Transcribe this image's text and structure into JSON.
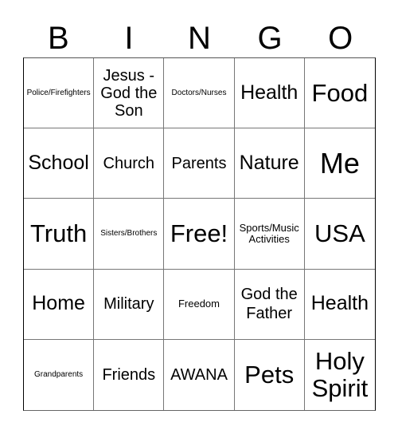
{
  "header": [
    "B",
    "I",
    "N",
    "G",
    "O"
  ],
  "cells": [
    "Police/Firefighters",
    "Jesus - God the Son",
    "Doctors/Nurses",
    "Health",
    "Food",
    "School",
    "Church",
    "Parents",
    "Nature",
    "Me",
    "Truth",
    "Sisters/Brothers",
    "Free!",
    "Sports/Music Activities",
    "USA",
    "Home",
    "Military",
    "Freedom",
    "God the Father",
    "Health",
    "Grandparents",
    "Friends",
    "AWANA",
    "Pets",
    "Holy Spirit"
  ]
}
